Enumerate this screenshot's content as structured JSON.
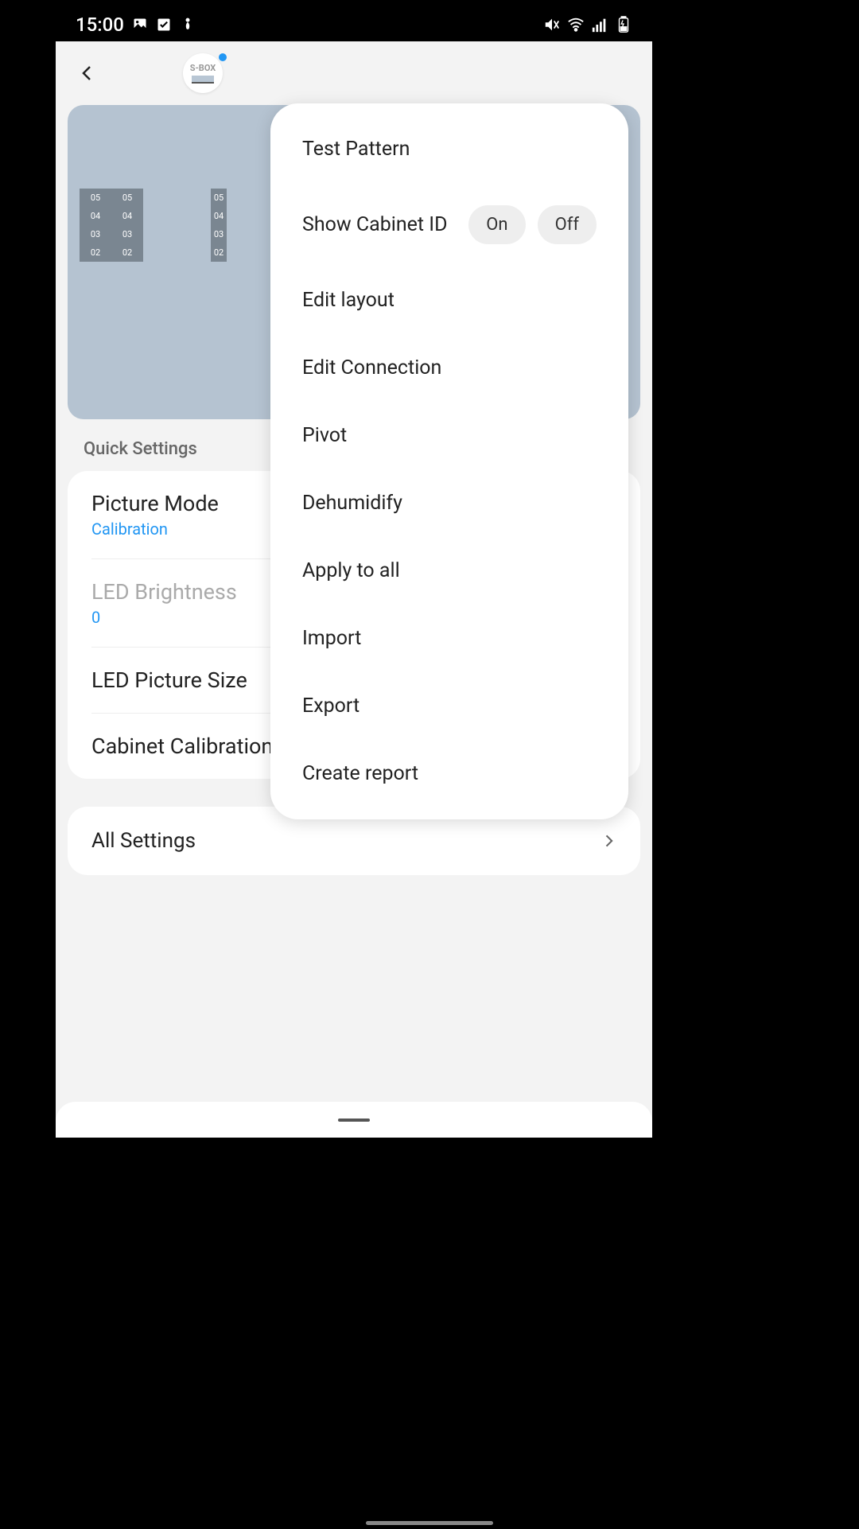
{
  "status": {
    "time": "15:00"
  },
  "header": {
    "sbox_label": "S-BOX"
  },
  "cabinet_rows": [
    "05",
    "04",
    "03",
    "02"
  ],
  "quick_settings_title": "Quick Settings",
  "settings": {
    "picture_mode": {
      "label": "Picture Mode",
      "value": "Calibration"
    },
    "led_brightness": {
      "label": "LED Brightness",
      "value": "0"
    },
    "led_picture_size": {
      "label": "LED Picture Size"
    },
    "cabinet_calibration": {
      "label": "Cabinet Calibration"
    }
  },
  "all_settings_label": "All Settings",
  "popup": {
    "test_pattern": "Test Pattern",
    "show_cabinet_id": "Show Cabinet ID",
    "on": "On",
    "off": "Off",
    "edit_layout": "Edit layout",
    "edit_connection": "Edit Connection",
    "pivot": "Pivot",
    "dehumidify": "Dehumidify",
    "apply_to_all": "Apply to all",
    "import": "Import",
    "export": "Export",
    "create_report": "Create report"
  }
}
